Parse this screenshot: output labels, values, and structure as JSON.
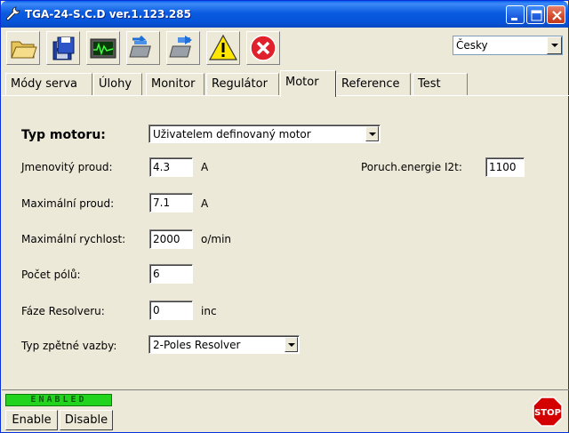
{
  "window": {
    "title": "TGA-24-S.C.D  ver.1.123.285"
  },
  "toolbar": {
    "buttons": [
      {
        "icon": "open-folder-icon"
      },
      {
        "icon": "save-disk-icon"
      },
      {
        "icon": "monitor-scope-icon"
      },
      {
        "icon": "download-chip-icon"
      },
      {
        "icon": "upload-chip-icon"
      },
      {
        "icon": "warning-icon"
      },
      {
        "icon": "error-close-icon"
      }
    ],
    "language": "Česky"
  },
  "tabs": [
    {
      "label": "Módy serva"
    },
    {
      "label": "Úlohy"
    },
    {
      "label": "Monitor"
    },
    {
      "label": "Regulátor"
    },
    {
      "label": "Motor",
      "active": true
    },
    {
      "label": "Reference"
    },
    {
      "label": "Test"
    }
  ],
  "motor": {
    "motor_type_label": "Typ motoru:",
    "motor_type_value": "Uživatelem definovaný motor",
    "rated_current_label": "Jmenovitý proud:",
    "rated_current_value": "4.3",
    "rated_current_unit": "A",
    "fault_energy_label": "Poruch.energie I2t:",
    "fault_energy_value": "1100",
    "max_current_label": "Maximální proud:",
    "max_current_value": "7.1",
    "max_current_unit": "A",
    "max_speed_label": "Maximální rychlost:",
    "max_speed_value": "2000",
    "max_speed_unit": "o/min",
    "poles_label": "Počet pólů:",
    "poles_value": "6",
    "resolver_phase_label": "Fáze Resolveru:",
    "resolver_phase_value": "0",
    "resolver_phase_unit": "inc",
    "feedback_type_label": "Typ zpětné vazby:",
    "feedback_type_value": "2-Poles Resolver"
  },
  "status": {
    "enabled_text": "ENABLED",
    "enable_label": "Enable",
    "disable_label": "Disable",
    "stop_text": "STOP"
  },
  "colors": {
    "title_bar": "#0A5BE0",
    "enabled_indicator": "#22D41E",
    "stop_red": "#D40000"
  }
}
